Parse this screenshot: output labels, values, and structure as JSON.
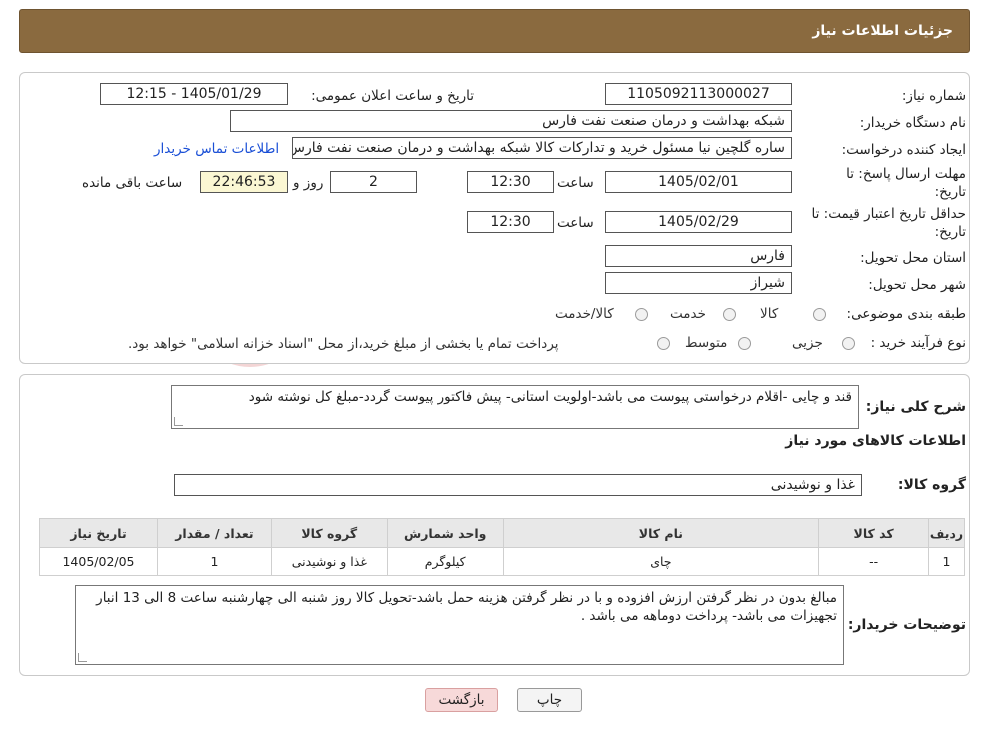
{
  "header": {
    "title": "جزئیات اطلاعات نیاز"
  },
  "form": {
    "need_number_label": "شماره نیاز:",
    "need_number": "1105092113000027",
    "announce_label": "تاریخ و ساعت اعلان عمومی:",
    "announce_value": "1405/01/29 - 12:15",
    "buyer_label": "نام دستگاه خریدار:",
    "buyer_value": "شبکه بهداشت و درمان صنعت نفت فارس",
    "creator_label": "ایجاد کننده درخواست:",
    "creator_value": "ساره گلچین نیا مسئول خرید و تدارکات کالا شبکه بهداشت و درمان صنعت نفت فارس",
    "contact_link": "اطلاعات تماس خریدار",
    "deadline_label_1": "مهلت ارسال پاسخ: تا",
    "deadline_label_2": "تاریخ:",
    "deadline_date": "1405/02/01",
    "time_label": "ساعت",
    "deadline_time": "12:30",
    "days_value": "2",
    "days_label": "روز و",
    "remaining_value": "22:46:53",
    "remaining_label": "ساعت باقی مانده",
    "validity_label_1": "حداقل تاریخ اعتبار قیمت: تا",
    "validity_label_2": "تاریخ:",
    "validity_date": "1405/02/29",
    "validity_time": "12:30",
    "province_label": "استان محل تحویل:",
    "province_value": "فارس",
    "city_label": "شهر محل تحویل:",
    "city_value": "شیراز",
    "category_label": "طبقه بندی موضوعی:",
    "category_options": [
      "کالا",
      "خدمت",
      "کالا/خدمت"
    ],
    "process_label": "نوع فرآیند خرید :",
    "process_options": [
      "جزیی",
      "متوسط"
    ],
    "process_note": "پرداخت تمام یا بخشی از مبلغ خرید،از محل \"اسناد خزانه اسلامی\" خواهد بود."
  },
  "details": {
    "description_label": "شرح کلی نیاز:",
    "description_text": "قند و چایی -اقلام درخواستی پیوست می باشد-اولویت استانی- پیش فاکتور پیوست گردد-مبلغ کل نوشته شود",
    "items_heading": "اطلاعات کالاهای مورد نیاز",
    "group_label": "گروه کالا:",
    "group_value": "غذا و نوشیدنی",
    "table": {
      "headers": [
        "ردیف",
        "کد کالا",
        "نام کالا",
        "واحد شمارش",
        "گروه کالا",
        "تعداد / مقدار",
        "تاریخ نیاز"
      ],
      "rows": [
        [
          "1",
          "--",
          "چای",
          "کیلوگرم",
          "غذا و نوشیدنی",
          "1",
          "1405/02/05"
        ]
      ]
    },
    "buyer_notes_label": "توضیحات خریدار:",
    "buyer_notes_text": "مبالغ بدون در نظر گرفتن ارزش افزوده و با در نظر گرفتن هزینه حمل باشد-تحویل کالا روز شنبه الی چهارشنبه ساعت 8 الی 13 انبار تجهیزات می باشد- پرداخت دوماهه می باشد ."
  },
  "buttons": {
    "print": "چاپ",
    "back": "بازگشت"
  },
  "colors": {
    "header_bg": "#8a6a3f",
    "link": "#1a4fd6",
    "back_button_bg": "#f7d9d9",
    "highlight_box": "#fbf7d3"
  }
}
